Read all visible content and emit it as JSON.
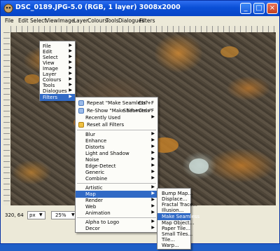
{
  "window": {
    "title": "DSC_0189.JPG-5.0 (RGB, 1 layer) 3008x2000",
    "title_buttons": [
      "_",
      "□",
      "×"
    ]
  },
  "menubar": {
    "items": [
      "File",
      "Edit",
      "Select",
      "View",
      "Image",
      "Layer",
      "Colours",
      "Tools",
      "Dialogues",
      "Filters"
    ]
  },
  "image_menu": {
    "items": [
      {
        "label": "File",
        "arrow": "▶"
      },
      {
        "label": "Edit",
        "arrow": "▶"
      },
      {
        "label": "Select",
        "arrow": "▶"
      },
      {
        "label": "View",
        "arrow": "▶"
      },
      {
        "label": "Image",
        "arrow": "▶"
      },
      {
        "label": "Layer",
        "arrow": "▶"
      },
      {
        "label": "Colours",
        "arrow": "▶"
      },
      {
        "label": "Tools",
        "arrow": "▶"
      },
      {
        "label": "Dialogues",
        "arrow": "▶"
      },
      {
        "label": "Filters",
        "arrow": "▶"
      }
    ]
  },
  "filters_menu": {
    "top": [
      {
        "label": "Repeat \"Make Seamless\"",
        "accel": "Ctrl+F"
      },
      {
        "label": "Re-Show \"Make Seamless\"",
        "accel": "Shift+Ctrl+F"
      },
      {
        "label": "Recently Used",
        "arrow": "▶"
      },
      {
        "label": "Reset all Filters",
        "accel": ""
      }
    ],
    "groups": [
      {
        "label": "Blur",
        "arrow": "▶"
      },
      {
        "label": "Enhance",
        "arrow": "▶"
      },
      {
        "label": "Distorts",
        "arrow": "▶"
      },
      {
        "label": "Light and Shadow",
        "arrow": "▶"
      },
      {
        "label": "Noise",
        "arrow": "▶"
      },
      {
        "label": "Edge-Detect",
        "arrow": "▶"
      },
      {
        "label": "Generic",
        "arrow": "▶"
      },
      {
        "label": "Combine",
        "arrow": "▶"
      },
      {
        "label": "Artistic",
        "arrow": "▶"
      },
      {
        "label": "Map",
        "arrow": "▶"
      },
      {
        "label": "Render",
        "arrow": "▶"
      },
      {
        "label": "Web",
        "arrow": "▶"
      },
      {
        "label": "Animation",
        "arrow": "▶"
      },
      {
        "label": "Alpha to Logo",
        "arrow": "▶"
      },
      {
        "label": "Decor",
        "arrow": "▶"
      }
    ]
  },
  "map_menu": {
    "items": [
      {
        "label": "Bump Map..."
      },
      {
        "label": "Displace..."
      },
      {
        "label": "Fractal Trace..."
      },
      {
        "label": "Illusion..."
      },
      {
        "label": "Make Seamless"
      },
      {
        "label": "Map Object..."
      },
      {
        "label": "Paper Tile..."
      },
      {
        "label": "Small Tiles..."
      },
      {
        "label": "Tile..."
      },
      {
        "label": "Warp..."
      }
    ]
  },
  "statusbar": {
    "coords": "320, 64",
    "unit": "px",
    "zoom": "25%",
    "unit_arrow": "▼",
    "zoom_arrow": "▼"
  },
  "colors": {
    "accent": "#316ac5",
    "titlebar": "#0a4fd6",
    "desktop": "#1f5fc7"
  }
}
